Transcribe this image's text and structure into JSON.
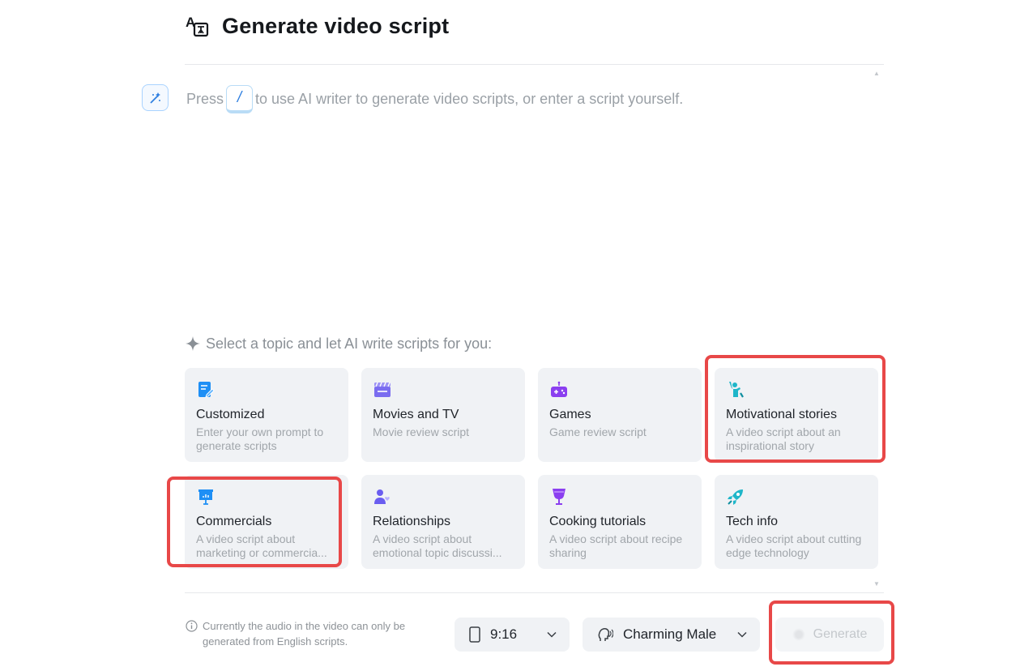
{
  "header": {
    "title": "Generate video script",
    "icon": "translate-video-icon"
  },
  "editor": {
    "hint_before": "Press",
    "slash_key": "/",
    "hint_after": "to use AI writer to generate video scripts, or enter a script yourself.",
    "wand_icon": "magic-wand-icon"
  },
  "topics": {
    "title": "Select a topic and let AI write scripts for you:",
    "items": [
      {
        "title": "Customized",
        "desc": "Enter your own prompt to generate scripts",
        "icon": "edit-note-icon",
        "color": "#1e8ff5"
      },
      {
        "title": "Movies and TV",
        "desc": "Movie review script",
        "icon": "clapperboard-icon",
        "color": "#7a6cf0"
      },
      {
        "title": "Games",
        "desc": "Game review script",
        "icon": "gamepad-icon",
        "color": "#8b3ff0"
      },
      {
        "title": "Motivational stories",
        "desc": "A video script about an inspirational story",
        "icon": "person-cheer-icon",
        "color": "#1fb6c9"
      },
      {
        "title": "Commercials",
        "desc": "A video script about marketing or commercia...",
        "icon": "presentation-board-icon",
        "color": "#1e8ff5"
      },
      {
        "title": "Relationships",
        "desc": "A video script about emotional topic discussi...",
        "icon": "person-heart-icon",
        "color": "#6a5df0"
      },
      {
        "title": "Cooking tutorials",
        "desc": "A video script about recipe sharing",
        "icon": "cocktail-glass-icon",
        "color": "#8b3ff0"
      },
      {
        "title": "Tech info",
        "desc": "A video script about cutting edge technology",
        "icon": "rocket-icon",
        "color": "#1fb6c9"
      }
    ]
  },
  "footer": {
    "notice": "Currently the audio in the video can only be generated from English scripts.",
    "ratio_label": "9:16",
    "voice_label": "Charming Male",
    "generate_label": "Generate"
  },
  "colors": {
    "highlight": "#e84848",
    "card_bg": "#f0f2f5",
    "accent": "#2f7fe0"
  }
}
